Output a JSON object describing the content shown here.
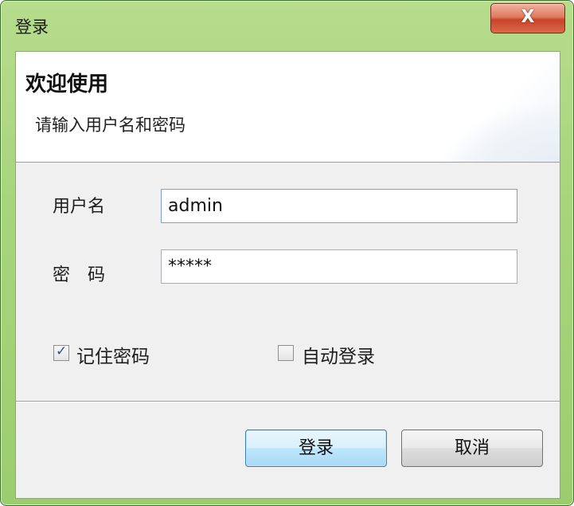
{
  "window": {
    "title": "登录",
    "close_glyph": "X"
  },
  "header": {
    "title": "欢迎使用",
    "subtitle": "请输入用户名和密码"
  },
  "form": {
    "username_label": "用户名",
    "username_value": "admin",
    "password_label": "密　码",
    "password_value": "*****"
  },
  "options": {
    "remember_label": "记住密码",
    "remember_checked": true,
    "autologin_label": "自动登录",
    "autologin_checked": false
  },
  "buttons": {
    "login_label": "登录",
    "cancel_label": "取消"
  },
  "colors": {
    "titlebar": "#a8d57c",
    "close_button": "#c8442a",
    "default_button_border": "#3c7fb1",
    "client_background": "#f0f0f0"
  },
  "icons": {
    "close": "close-icon",
    "check": "checkmark-icon"
  }
}
